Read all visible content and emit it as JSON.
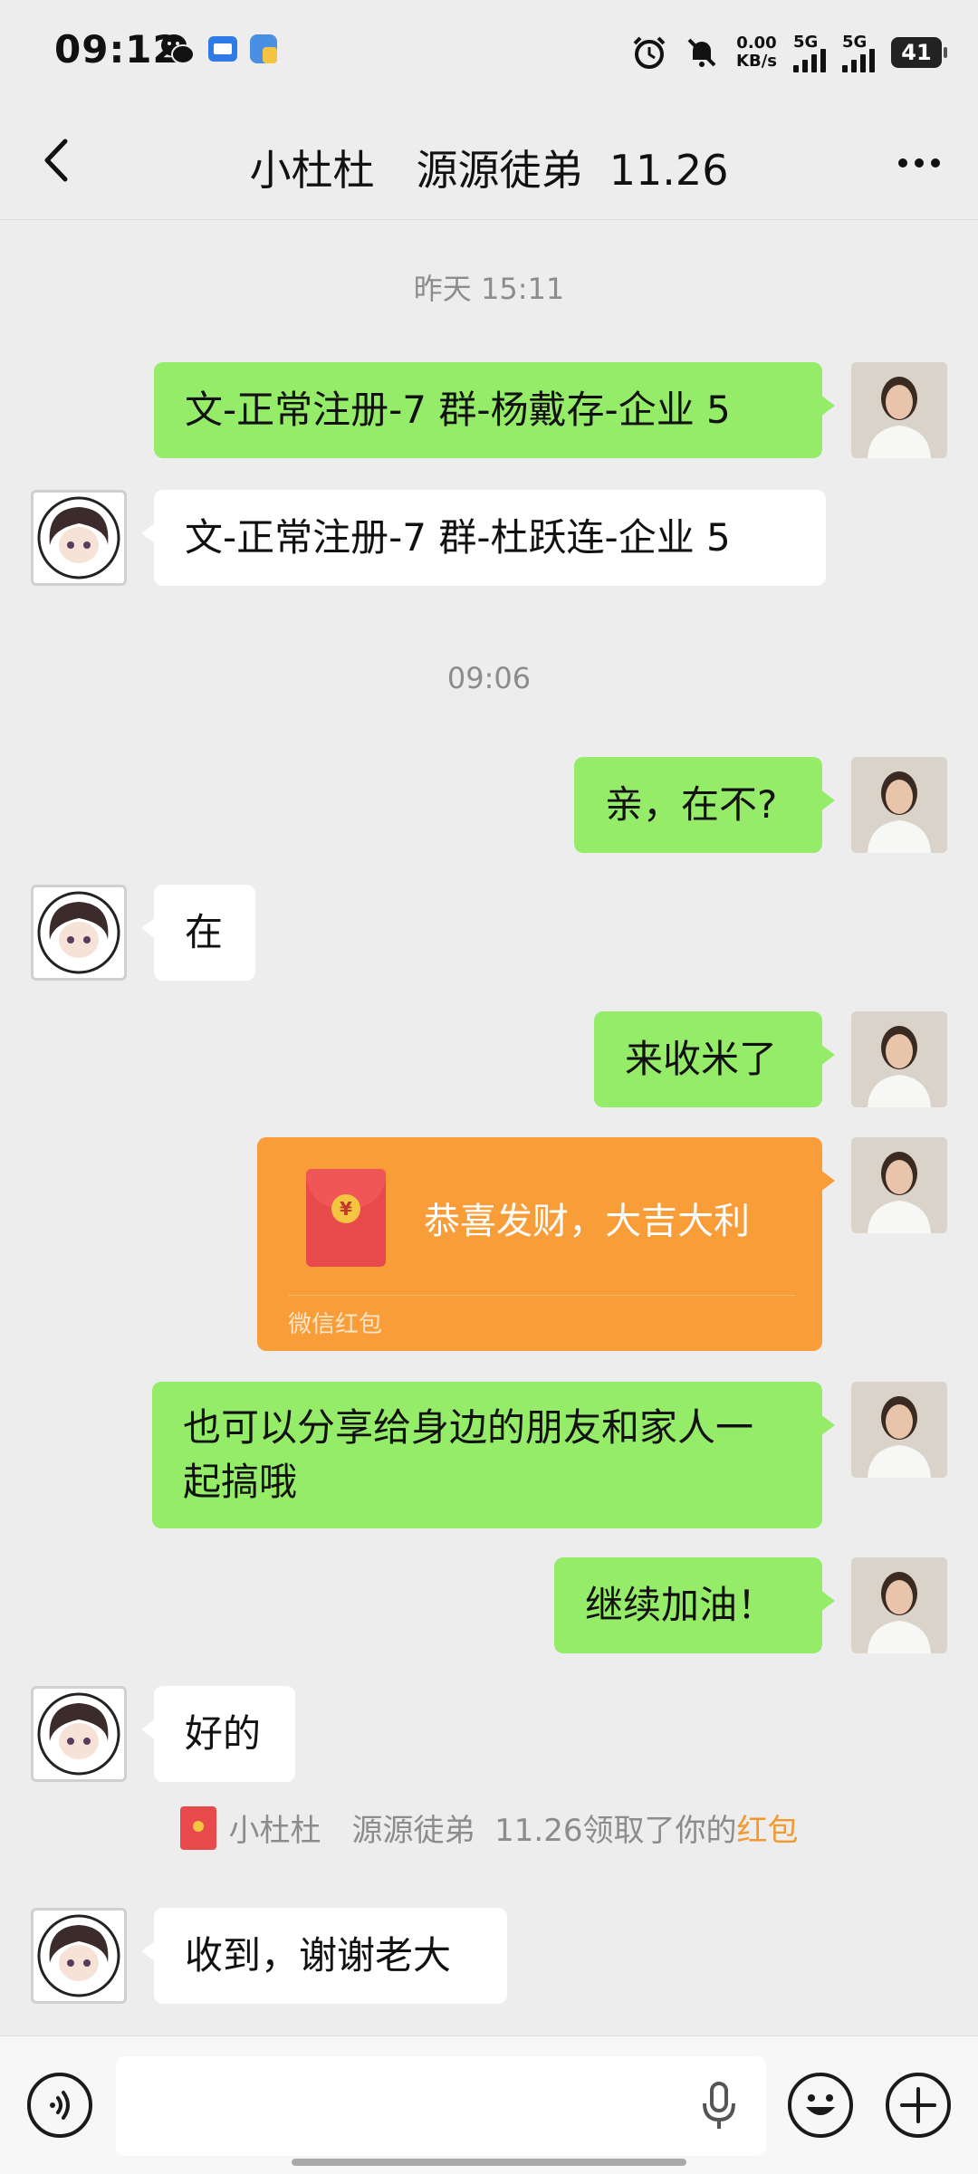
{
  "status_bar": {
    "time": "09:12",
    "net_speed_value": "0.00",
    "net_speed_unit": "KB/s",
    "signal1_label": "5G",
    "signal2_label": "5G",
    "battery": "41",
    "icons": [
      "wechat-icon",
      "app-icon",
      "files-icon",
      "alarm-icon",
      "mute-icon"
    ]
  },
  "header": {
    "title": "小杜杜　源源徒弟  11.26"
  },
  "messages": {
    "time1": "昨天 15:11",
    "m1": "文-正常注册-7 群-杨戴存-企业 5",
    "m2": "文-正常注册-7 群-杜跃连-企业 5",
    "time2": "09:06",
    "m3": "亲，在不?",
    "m4": "在",
    "m5": "来收米了",
    "red_packet": {
      "greeting": "恭喜发财，大吉大利",
      "footer": "微信红包"
    },
    "m6_line1": "也可以分享给身边的朋友和家人一",
    "m6_line2": "起搞哦",
    "m7": "继续加油！",
    "m8": "好的",
    "system_notice": {
      "text": "小杜杜　源源徒弟  11.26领取了你的",
      "link": "红包"
    },
    "m9": "收到，谢谢老大"
  },
  "colors": {
    "my_bubble": "#95ec69",
    "their_bubble": "#ffffff",
    "red_packet": "#f99d39",
    "background": "#ededed",
    "link": "#f39a2f"
  }
}
